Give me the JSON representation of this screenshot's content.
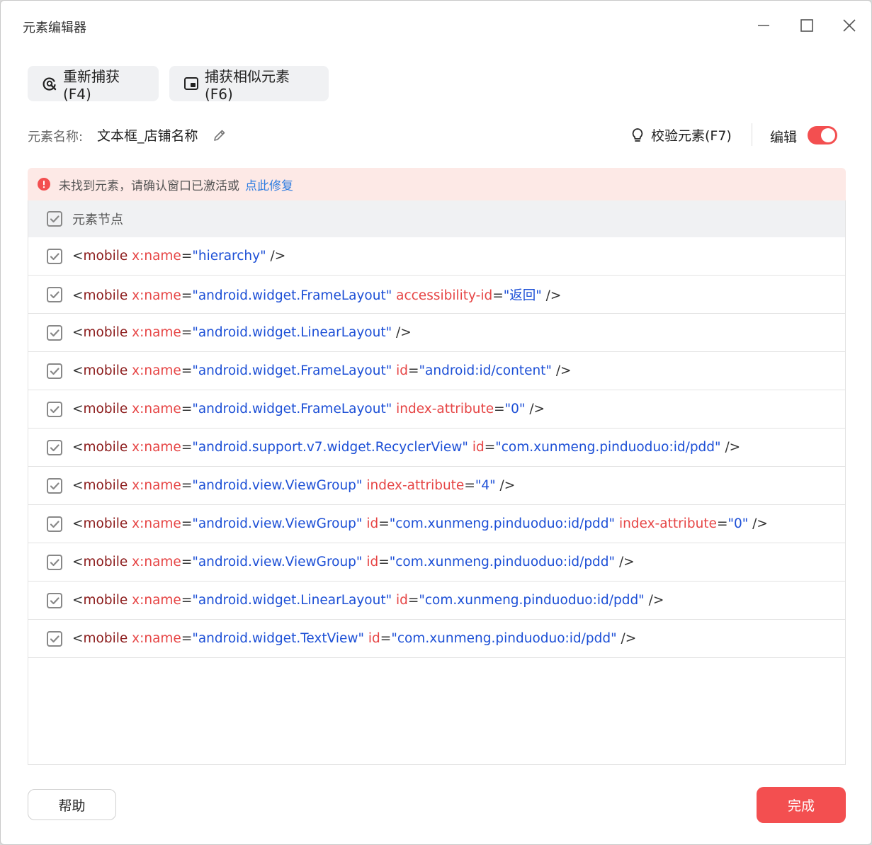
{
  "window": {
    "title": "元素编辑器"
  },
  "toolbar": {
    "recapture_label": "重新捕获(F4)",
    "capture_similar_label": "捕获相似元素(F6)"
  },
  "element": {
    "name_label": "元素名称:",
    "name_value": "文本框_店铺名称",
    "verify_label": "校验元素(F7)",
    "edit_label": "编辑",
    "edit_enabled": true
  },
  "alert": {
    "message": "未找到元素，请确认窗口已激活或",
    "link": "点此修复"
  },
  "tree": {
    "header": "元素节点",
    "rows": [
      {
        "checked": true,
        "tokens": [
          {
            "t": "punc",
            "v": "<"
          },
          {
            "t": "tag",
            "v": "mobile "
          },
          {
            "t": "attr",
            "v": "x:name"
          },
          {
            "t": "punc",
            "v": "="
          },
          {
            "t": "val",
            "v": "\"hierarchy\""
          },
          {
            "t": "punc",
            "v": " />"
          }
        ]
      },
      {
        "checked": true,
        "tokens": [
          {
            "t": "punc",
            "v": "<"
          },
          {
            "t": "tag",
            "v": "mobile "
          },
          {
            "t": "attr",
            "v": "x:name"
          },
          {
            "t": "punc",
            "v": "="
          },
          {
            "t": "val",
            "v": "\"android.widget.FrameLayout\""
          },
          {
            "t": "attr",
            "v": " accessibility-id"
          },
          {
            "t": "punc",
            "v": "="
          },
          {
            "t": "val",
            "v": "\"返回\""
          },
          {
            "t": "punc",
            "v": " />"
          }
        ]
      },
      {
        "checked": true,
        "tokens": [
          {
            "t": "punc",
            "v": "<"
          },
          {
            "t": "tag",
            "v": "mobile "
          },
          {
            "t": "attr",
            "v": "x:name"
          },
          {
            "t": "punc",
            "v": "="
          },
          {
            "t": "val",
            "v": "\"android.widget.LinearLayout\""
          },
          {
            "t": "punc",
            "v": " />"
          }
        ]
      },
      {
        "checked": true,
        "tokens": [
          {
            "t": "punc",
            "v": "<"
          },
          {
            "t": "tag",
            "v": "mobile "
          },
          {
            "t": "attr",
            "v": "x:name"
          },
          {
            "t": "punc",
            "v": "="
          },
          {
            "t": "val",
            "v": "\"android.widget.FrameLayout\""
          },
          {
            "t": "attr",
            "v": " id"
          },
          {
            "t": "punc",
            "v": "="
          },
          {
            "t": "val",
            "v": "\"android:id/content\""
          },
          {
            "t": "punc",
            "v": " />"
          }
        ]
      },
      {
        "checked": true,
        "tokens": [
          {
            "t": "punc",
            "v": "<"
          },
          {
            "t": "tag",
            "v": "mobile "
          },
          {
            "t": "attr",
            "v": "x:name"
          },
          {
            "t": "punc",
            "v": "="
          },
          {
            "t": "val",
            "v": "\"android.widget.FrameLayout\""
          },
          {
            "t": "attr",
            "v": " index-attribute"
          },
          {
            "t": "punc",
            "v": "="
          },
          {
            "t": "val",
            "v": "\"0\""
          },
          {
            "t": "punc",
            "v": " />"
          }
        ]
      },
      {
        "checked": true,
        "tokens": [
          {
            "t": "punc",
            "v": "<"
          },
          {
            "t": "tag",
            "v": "mobile "
          },
          {
            "t": "attr",
            "v": "x:name"
          },
          {
            "t": "punc",
            "v": "="
          },
          {
            "t": "val",
            "v": "\"android.support.v7.widget.RecyclerView\""
          },
          {
            "t": "attr",
            "v": " id"
          },
          {
            "t": "punc",
            "v": "="
          },
          {
            "t": "val",
            "v": "\"com.xunmeng.pinduoduo:id/pdd\""
          },
          {
            "t": "punc",
            "v": " />"
          }
        ]
      },
      {
        "checked": true,
        "tokens": [
          {
            "t": "punc",
            "v": "<"
          },
          {
            "t": "tag",
            "v": "mobile "
          },
          {
            "t": "attr",
            "v": "x:name"
          },
          {
            "t": "punc",
            "v": "="
          },
          {
            "t": "val",
            "v": "\"android.view.ViewGroup\""
          },
          {
            "t": "attr",
            "v": " index-attribute"
          },
          {
            "t": "punc",
            "v": "="
          },
          {
            "t": "val",
            "v": "\"4\""
          },
          {
            "t": "punc",
            "v": " />"
          }
        ]
      },
      {
        "checked": true,
        "tokens": [
          {
            "t": "punc",
            "v": "<"
          },
          {
            "t": "tag",
            "v": "mobile "
          },
          {
            "t": "attr",
            "v": "x:name"
          },
          {
            "t": "punc",
            "v": "="
          },
          {
            "t": "val",
            "v": "\"android.view.ViewGroup\""
          },
          {
            "t": "attr",
            "v": " id"
          },
          {
            "t": "punc",
            "v": "="
          },
          {
            "t": "val",
            "v": "\"com.xunmeng.pinduoduo:id/pdd\""
          },
          {
            "t": "attr",
            "v": " index-attribute"
          },
          {
            "t": "punc",
            "v": "="
          },
          {
            "t": "val",
            "v": "\"0\""
          },
          {
            "t": "punc",
            "v": " />"
          }
        ]
      },
      {
        "checked": true,
        "tokens": [
          {
            "t": "punc",
            "v": "<"
          },
          {
            "t": "tag",
            "v": "mobile "
          },
          {
            "t": "attr",
            "v": "x:name"
          },
          {
            "t": "punc",
            "v": "="
          },
          {
            "t": "val",
            "v": "\"android.view.ViewGroup\""
          },
          {
            "t": "attr",
            "v": " id"
          },
          {
            "t": "punc",
            "v": "="
          },
          {
            "t": "val",
            "v": "\"com.xunmeng.pinduoduo:id/pdd\""
          },
          {
            "t": "punc",
            "v": " />"
          }
        ]
      },
      {
        "checked": true,
        "tokens": [
          {
            "t": "punc",
            "v": "<"
          },
          {
            "t": "tag",
            "v": "mobile "
          },
          {
            "t": "attr",
            "v": "x:name"
          },
          {
            "t": "punc",
            "v": "="
          },
          {
            "t": "val",
            "v": "\"android.widget.LinearLayout\""
          },
          {
            "t": "attr",
            "v": " id"
          },
          {
            "t": "punc",
            "v": "="
          },
          {
            "t": "val",
            "v": "\"com.xunmeng.pinduoduo:id/pdd\""
          },
          {
            "t": "punc",
            "v": " />"
          }
        ]
      },
      {
        "checked": true,
        "tokens": [
          {
            "t": "punc",
            "v": "<"
          },
          {
            "t": "tag",
            "v": "mobile "
          },
          {
            "t": "attr",
            "v": "x:name"
          },
          {
            "t": "punc",
            "v": "="
          },
          {
            "t": "val",
            "v": "\"android.widget.TextView\""
          },
          {
            "t": "attr",
            "v": " id"
          },
          {
            "t": "punc",
            "v": "="
          },
          {
            "t": "val",
            "v": "\"com.xunmeng.pinduoduo:id/pdd\""
          },
          {
            "t": "punc",
            "v": " />"
          }
        ]
      }
    ]
  },
  "footer": {
    "help_label": "帮助",
    "done_label": "完成"
  },
  "colors": {
    "accent": "#f34f50",
    "link": "#2f7de1",
    "tag": "#8b1a1a",
    "attr": "#e64545",
    "value": "#1c4fd6"
  },
  "icons": [
    "recapture-icon",
    "capture-similar-icon",
    "pencil-icon",
    "bulb-icon",
    "error-icon",
    "checkbox-checked-icon",
    "minimize-icon",
    "maximize-icon",
    "close-icon"
  ]
}
